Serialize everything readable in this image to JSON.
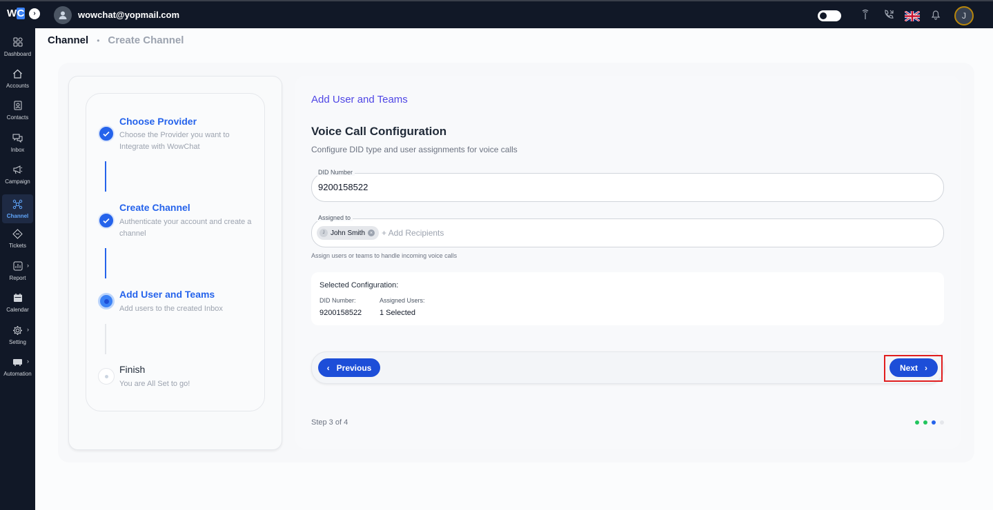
{
  "topbar": {
    "logo_text": "WC",
    "email": "wowchat@yopmail.com",
    "avatar_initial": "J"
  },
  "sidebar": {
    "items": [
      {
        "label": "Dashboard",
        "icon": "grid-icon"
      },
      {
        "label": "Accounts",
        "icon": "home-icon"
      },
      {
        "label": "Contacts",
        "icon": "contact-card-icon"
      },
      {
        "label": "Inbox",
        "icon": "chat-bubbles-icon"
      },
      {
        "label": "Campaign",
        "icon": "megaphone-icon"
      },
      {
        "label": "Channel",
        "icon": "network-icon",
        "active": true
      },
      {
        "label": "Tickets",
        "icon": "ticket-icon"
      },
      {
        "label": "Report",
        "icon": "chart-icon"
      },
      {
        "label": "Calendar",
        "icon": "calendar-icon"
      },
      {
        "label": "Setting",
        "icon": "gear-icon"
      },
      {
        "label": "Automation",
        "icon": "automation-icon"
      }
    ]
  },
  "breadcrumb": {
    "current": "Channel",
    "link": "Create Channel"
  },
  "stepper": {
    "steps": [
      {
        "title": "Choose Provider",
        "desc": "Choose the Provider you want to Integrate with WowChat",
        "state": "done"
      },
      {
        "title": "Create Channel",
        "desc": "Authenticate your account and create a channel",
        "state": "done"
      },
      {
        "title": "Add User and Teams",
        "desc": "Add users to the created Inbox",
        "state": "current"
      },
      {
        "title": "Finish",
        "desc": "You are All Set to go!",
        "state": "pending"
      }
    ]
  },
  "form": {
    "section_title": "Add User and Teams",
    "heading": "Voice Call Configuration",
    "subheading": "Configure DID type and user assignments for voice calls",
    "did_label": "DID Number",
    "did_value": "9200158522",
    "assigned_label": "Assigned to",
    "chip_initial": "J",
    "chip_name": "John Smith",
    "add_recipients": "+ Add Recipients",
    "helper": "Assign users or teams to handle incoming voice calls"
  },
  "summary": {
    "title": "Selected Configuration:",
    "did_label": "DID Number:",
    "did_value": "9200158522",
    "users_label": "Assigned Users:",
    "users_value": "1 Selected"
  },
  "navigation": {
    "previous": "Previous",
    "next": "Next",
    "step_text": "Step 3 of 4"
  },
  "progress_dots": [
    "#22c55e",
    "#22c55e",
    "#2563eb",
    "#e5e7eb"
  ],
  "colors": {
    "accent": "#1d4ed8",
    "highlight": "#e11d1d"
  }
}
